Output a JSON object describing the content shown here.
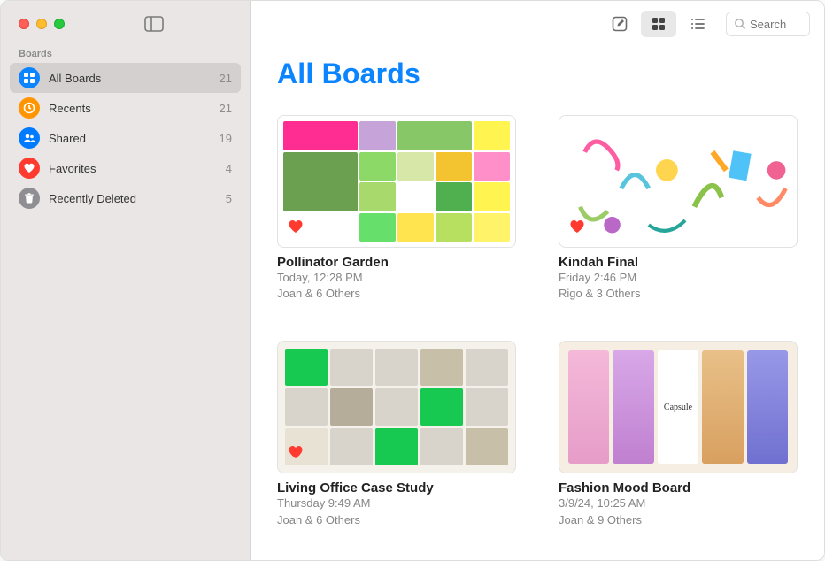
{
  "sidebar": {
    "header": "Boards",
    "items": [
      {
        "label": "All Boards",
        "count": "21",
        "icon": "grid-icon",
        "color": "#0a84ff",
        "selected": true
      },
      {
        "label": "Recents",
        "count": "21",
        "icon": "clock-icon",
        "color": "#ff9500",
        "selected": false
      },
      {
        "label": "Shared",
        "count": "19",
        "icon": "people-icon",
        "color": "#007aff",
        "selected": false
      },
      {
        "label": "Favorites",
        "count": "4",
        "icon": "heart-icon",
        "color": "#ff3b30",
        "selected": false
      },
      {
        "label": "Recently Deleted",
        "count": "5",
        "icon": "trash-icon",
        "color": "#8e8e93",
        "selected": false
      }
    ]
  },
  "toolbar": {
    "compose": "compose",
    "grid": "grid",
    "list": "list",
    "search_placeholder": "Search"
  },
  "page": {
    "title": "All Boards"
  },
  "boards": [
    {
      "title": "Pollinator Garden",
      "timestamp": "Today, 12:28 PM",
      "people": "Joan & 6 Others",
      "favorite": true
    },
    {
      "title": "Kindah Final",
      "timestamp": "Friday 2:46 PM",
      "people": "Rigo & 3 Others",
      "favorite": true
    },
    {
      "title": "Living Office Case Study",
      "timestamp": "Thursday 9:49 AM",
      "people": "Joan & 6 Others",
      "favorite": true
    },
    {
      "title": "Fashion Mood Board",
      "timestamp": "3/9/24, 10:25 AM",
      "people": "Joan & 9 Others",
      "favorite": false
    }
  ]
}
